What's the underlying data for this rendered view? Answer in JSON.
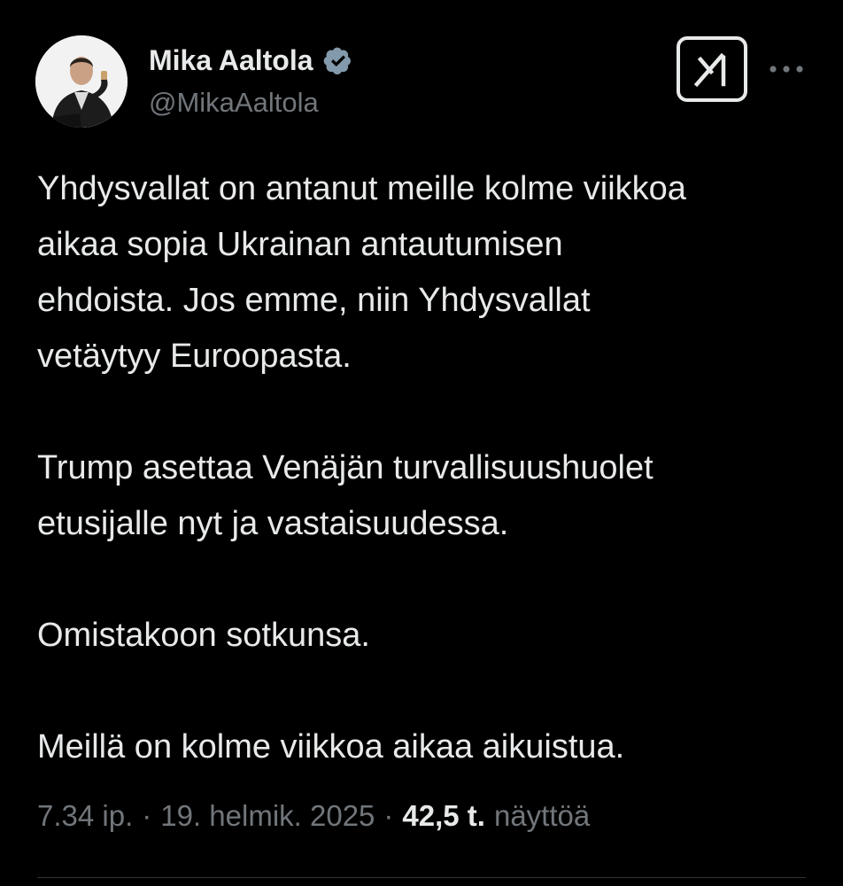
{
  "author": {
    "name": "Mika Aaltola",
    "handle": "@MikaAaltola",
    "verified": true
  },
  "icons": {
    "avatar": "profile-photo",
    "verified": "verified-badge-icon",
    "grok": "grok-icon",
    "more": "more-options-icon"
  },
  "tweet": {
    "paragraphs": [
      "Yhdysvallat on antanut meille kolme viikkoa\naikaa sopia Ukrainan antautumisen\nehdoista. Jos emme, niin Yhdysvallat\nvetäytyy Euroopasta.",
      "Trump asettaa Venäjän turvallisuushuolet\netusijalle nyt ja vastaisuudessa.",
      "Omistakoon sotkunsa.",
      "Meillä on kolme viikkoa aikaa aikuistua."
    ]
  },
  "meta": {
    "time": "7.34 ip.",
    "separator": "·",
    "date": "19. helmik. 2025",
    "views_count": "42,5 t.",
    "views_label": "näyttöä"
  },
  "colors": {
    "background": "#000000",
    "text": "#e7e9ea",
    "secondary_text": "#71767b",
    "verified": "#829aab",
    "divider": "#2f3336"
  }
}
